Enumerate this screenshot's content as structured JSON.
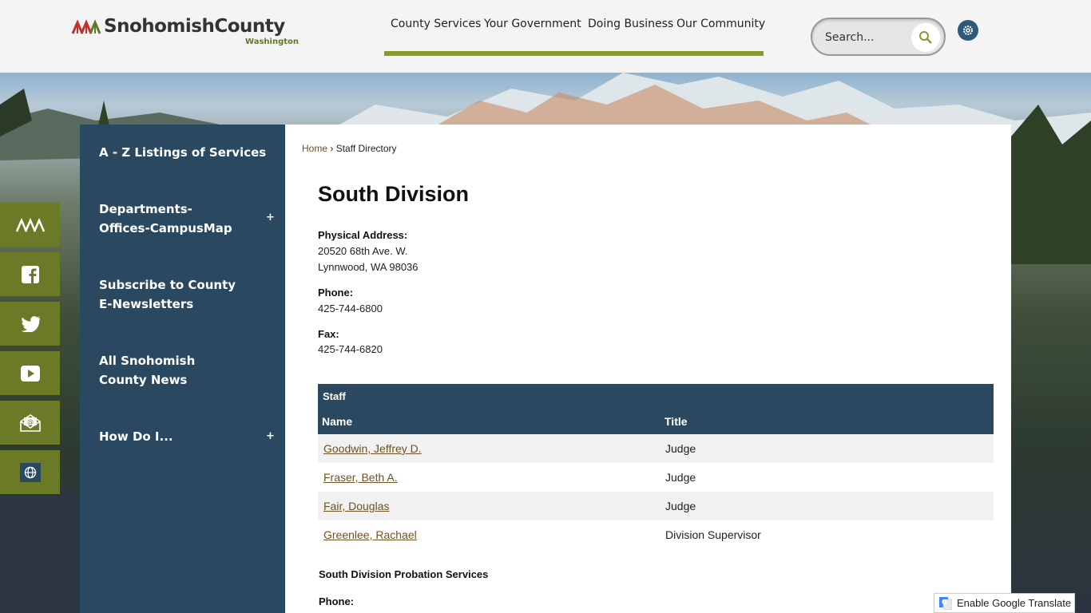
{
  "header": {
    "logo_text": "SnohomishCounty",
    "logo_sub": "Washington",
    "nav": [
      "County Services",
      "Your Government",
      "Doing Business",
      "Our Community"
    ],
    "search_placeholder": "Search..."
  },
  "leftnav": {
    "items": [
      {
        "label": "A - Z Listings of Services",
        "expandable": false
      },
      {
        "label": "Departments-Offices-CampusMap",
        "expandable": true
      },
      {
        "label": "Subscribe to County E-Newsletters",
        "expandable": false
      },
      {
        "label": "All Snohomish County News",
        "expandable": false
      },
      {
        "label": "How Do I...",
        "expandable": true
      }
    ],
    "plus": "+"
  },
  "social": [
    "county-logo-icon",
    "facebook-icon",
    "twitter-icon",
    "youtube-icon",
    "email-newsletter-icon",
    "translate-globe-icon"
  ],
  "breadcrumb": {
    "home": "Home",
    "sep": "›",
    "current": "Staff Directory"
  },
  "page": {
    "title": "South Division",
    "physical_label": "Physical Address:",
    "address_line1": "20520 68th Ave. W.",
    "address_line2": "Lynnwood, WA 98036",
    "phone_label": "Phone:",
    "phone": "425-744-6800",
    "fax_label": "Fax:",
    "fax": "425-744-6820",
    "section2_title": "South Division Probation Services",
    "section2_phone_label": "Phone:"
  },
  "staff_table": {
    "caption": "Staff",
    "col_name": "Name",
    "col_title": "Title",
    "rows": [
      {
        "name": "Goodwin, Jeffrey D.",
        "title": "Judge"
      },
      {
        "name": "Fraser, Beth A.",
        "title": "Judge"
      },
      {
        "name": "Fair, Douglas",
        "title": "Judge"
      },
      {
        "name": "Greenlee, Rachael",
        "title": "Division Supervisor"
      }
    ]
  },
  "translate": {
    "label": "Enable Google Translate"
  },
  "colors": {
    "nav_bar": "#8a9a2a",
    "sidebar": "#2a4860",
    "social": "#6b7a26",
    "link": "#6b5324"
  }
}
